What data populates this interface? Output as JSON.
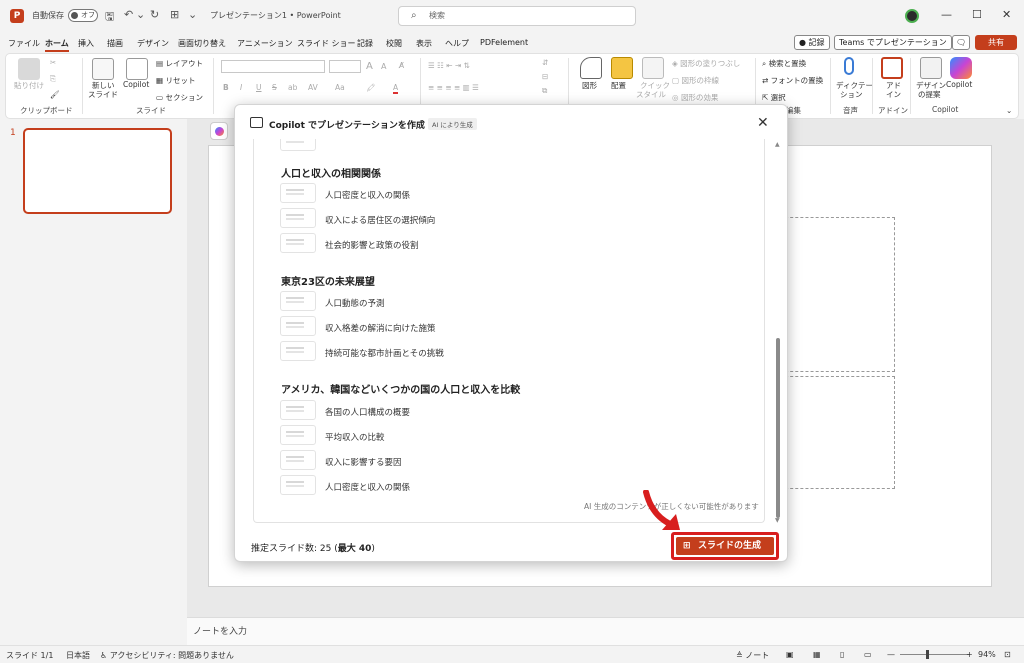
{
  "titlebar": {
    "autosave_label": "自動保存",
    "autosave_state": "オフ",
    "doc_title": "プレゼンテーション1 • PowerPoint",
    "search_placeholder": "検索",
    "window_controls": [
      "—",
      "☐",
      "✕"
    ]
  },
  "menu": {
    "tabs": [
      "ファイル",
      "ホーム",
      "挿入",
      "描画",
      "デザイン",
      "画面切り替え",
      "アニメーション",
      "スライド ショー",
      "記録",
      "校閲",
      "表示",
      "ヘルプ",
      "PDFelement"
    ],
    "active_tab": "ホーム",
    "record_button": "記録",
    "teams_button": "Teams でプレゼンテーション",
    "share_button": "共有"
  },
  "ribbon": {
    "clipboard": {
      "paste": "貼り付け",
      "group": "クリップボード"
    },
    "slides": {
      "new_slide_1": "新しい",
      "new_slide_2": "スライド",
      "copilot": "Copilot",
      "layout": "レイアウト",
      "reset": "リセット",
      "section": "セクション",
      "group": "スライド"
    },
    "font": {
      "grow": "A",
      "shrink": "A",
      "bold": "B",
      "italic": "I",
      "underline": "U",
      "strike": "S",
      "ab": "ab",
      "av": "AV",
      "aa": "Aa",
      "color": "A"
    },
    "drawing": {
      "shape": "図形",
      "arrange": "配置",
      "quick_style_1": "クイック",
      "quick_style_2": "スタイル",
      "fill": "図形の塗りつぶし",
      "outline": "図形の枠線",
      "effect": "図形の効果"
    },
    "editing": {
      "find_replace": "検索と置換",
      "replace_font": "フォントの置換",
      "select": "選択",
      "group": "編集"
    },
    "voice": {
      "dictate_1": "ディクテー",
      "dictate_2": "ション",
      "group": "音声"
    },
    "addins": {
      "label_1": "アド",
      "label_2": "イン",
      "group": "アドイン"
    },
    "designer": {
      "label_1": "デザイン",
      "label_2": "の提案"
    },
    "copilot": {
      "label": "Copilot",
      "group": "Copilot"
    }
  },
  "slides_pane": {
    "number": "1"
  },
  "dialog": {
    "title": "Copilot でプレゼンテーションを作成",
    "badge": "AI により生成",
    "sections": [
      {
        "title": "人口と収入の相関関係",
        "items": [
          "人口密度と収入の関係",
          "収入による居住区の選択傾向",
          "社会的影響と政策の役割"
        ]
      },
      {
        "title": "東京23区の未来展望",
        "items": [
          "人口動態の予測",
          "収入格差の解消に向けた施策",
          "持続可能な都市計画とその挑戦"
        ]
      },
      {
        "title": "アメリカ、韓国などいくつかの国の人口と収入を比較",
        "items": [
          "各国の人口構成の概要",
          "平均収入の比較",
          "収入に影響する要因",
          "人口密度と収入の関係"
        ]
      }
    ],
    "disclaimer": "AI 生成のコンテンツが正しくない可能性があります",
    "footer_prefix": "推定スライド数: 25 (",
    "footer_max": "最大 40",
    "footer_suffix": ")",
    "generate_button": "スライドの生成"
  },
  "notes": {
    "placeholder": "ノートを入力"
  },
  "status": {
    "slide": "スライド 1/1",
    "language": "日本語",
    "accessibility": "アクセシビリティ: 問題ありません",
    "notes_btn": "ノート",
    "zoom": "94%"
  },
  "colors": {
    "accent": "#c43e1c",
    "highlight": "#d81e1e"
  }
}
